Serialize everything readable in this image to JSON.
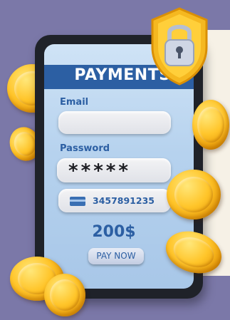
{
  "payment": {
    "title": "PAYMENTS",
    "email_label": "Email",
    "email_value": "",
    "password_label": "Password",
    "password_masked": "*****",
    "card_number": "3457891235",
    "amount": "200$",
    "pay_button": "PAY NOW"
  },
  "colors": {
    "background": "#7b78a8",
    "accent": "#2c5fa3",
    "coin": "#ffc52a",
    "shield": "#f5b820"
  },
  "icons": [
    "padlock-shield-icon",
    "credit-card-icon",
    "coin-icon"
  ]
}
